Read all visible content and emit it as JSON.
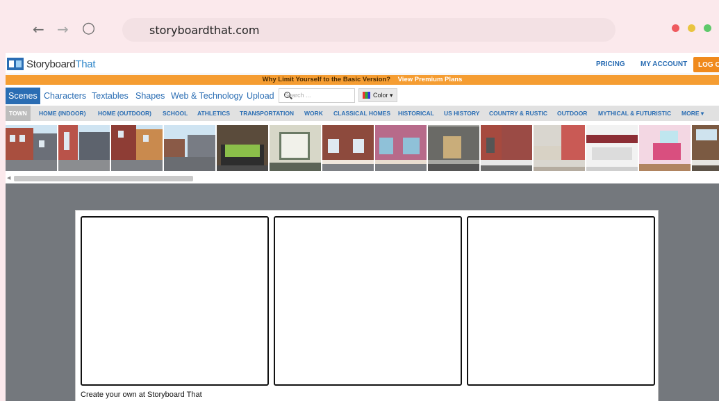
{
  "browser": {
    "url": "storyboardthat.com",
    "back_icon": "←",
    "forward_icon": "→",
    "reload_icon": "○"
  },
  "header": {
    "logo_part1": "Storyboard",
    "logo_part2": "That",
    "links": [
      "PRICING",
      "MY ACCOUNT"
    ],
    "logout": "LOG OU"
  },
  "promo": {
    "text": "Why Limit Yourself to the Basic Version?",
    "link": "View Premium Plans"
  },
  "tabs": [
    "Scenes",
    "Characters",
    "Textables",
    "Shapes",
    "Web & Technology",
    "Upload"
  ],
  "search": {
    "placeholder": "Search ..."
  },
  "color_button": "Color ▾",
  "categories": [
    "TOWN",
    "HOME (INDOOR)",
    "HOME (OUTDOOR)",
    "SCHOOL",
    "ATHLETICS",
    "TRANSPORTATION",
    "WORK",
    "CLASSICAL HOMES",
    "HISTORICAL",
    "US HISTORY",
    "COUNTRY & RUSTIC",
    "OUTDOOR",
    "MYTHICAL & FUTURISTIC",
    "MORE ▾"
  ],
  "storyboard": {
    "caption": "Create your own at Storyboard That"
  },
  "colors": {
    "brand_blue": "#2a6db3",
    "promo_orange": "#f59d32",
    "workspace_gray": "#74787d"
  }
}
